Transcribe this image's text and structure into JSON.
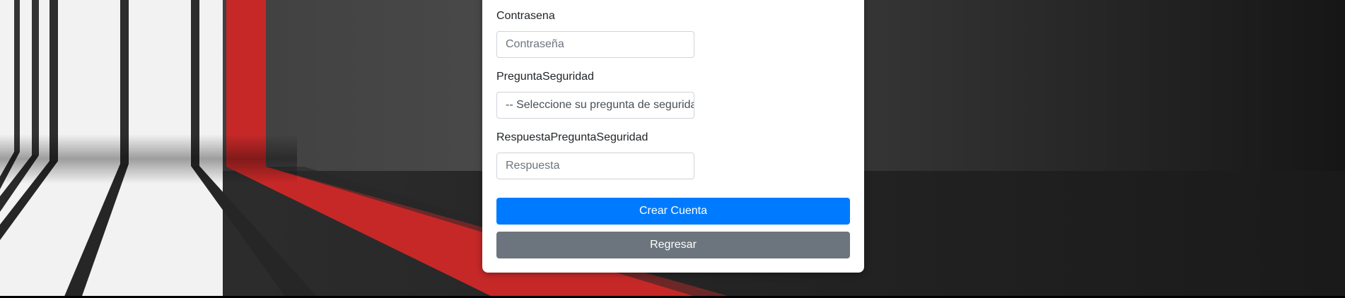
{
  "form": {
    "password": {
      "label": "Contrasena",
      "placeholder": "Contraseña"
    },
    "security_question": {
      "label": "PreguntaSeguridad",
      "selected": "-- Seleccione su pregunta de seguridad --"
    },
    "security_answer": {
      "label": "RespuestaPreguntaSeguridad",
      "placeholder": "Respuesta"
    },
    "create_button": "Crear Cuenta",
    "back_button": "Regresar"
  },
  "colors": {
    "primary": "#007bff",
    "secondary": "#6c757d",
    "accent_red": "#c62828"
  }
}
